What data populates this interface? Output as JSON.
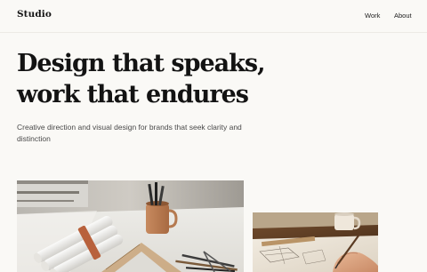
{
  "header": {
    "brand": "Studio",
    "nav": [
      {
        "label": "Work"
      },
      {
        "label": "About"
      }
    ]
  },
  "hero": {
    "headline_lines": [
      "Design that speaks,",
      "work that endures"
    ],
    "subtitle_lines": [
      "Creative direction and visual design for brands that seek clarity and",
      "distinction"
    ]
  },
  "gallery": {
    "images": [
      {
        "icon": "desk-workspace-photo"
      },
      {
        "icon": "sketching-hand-photo"
      }
    ]
  }
}
